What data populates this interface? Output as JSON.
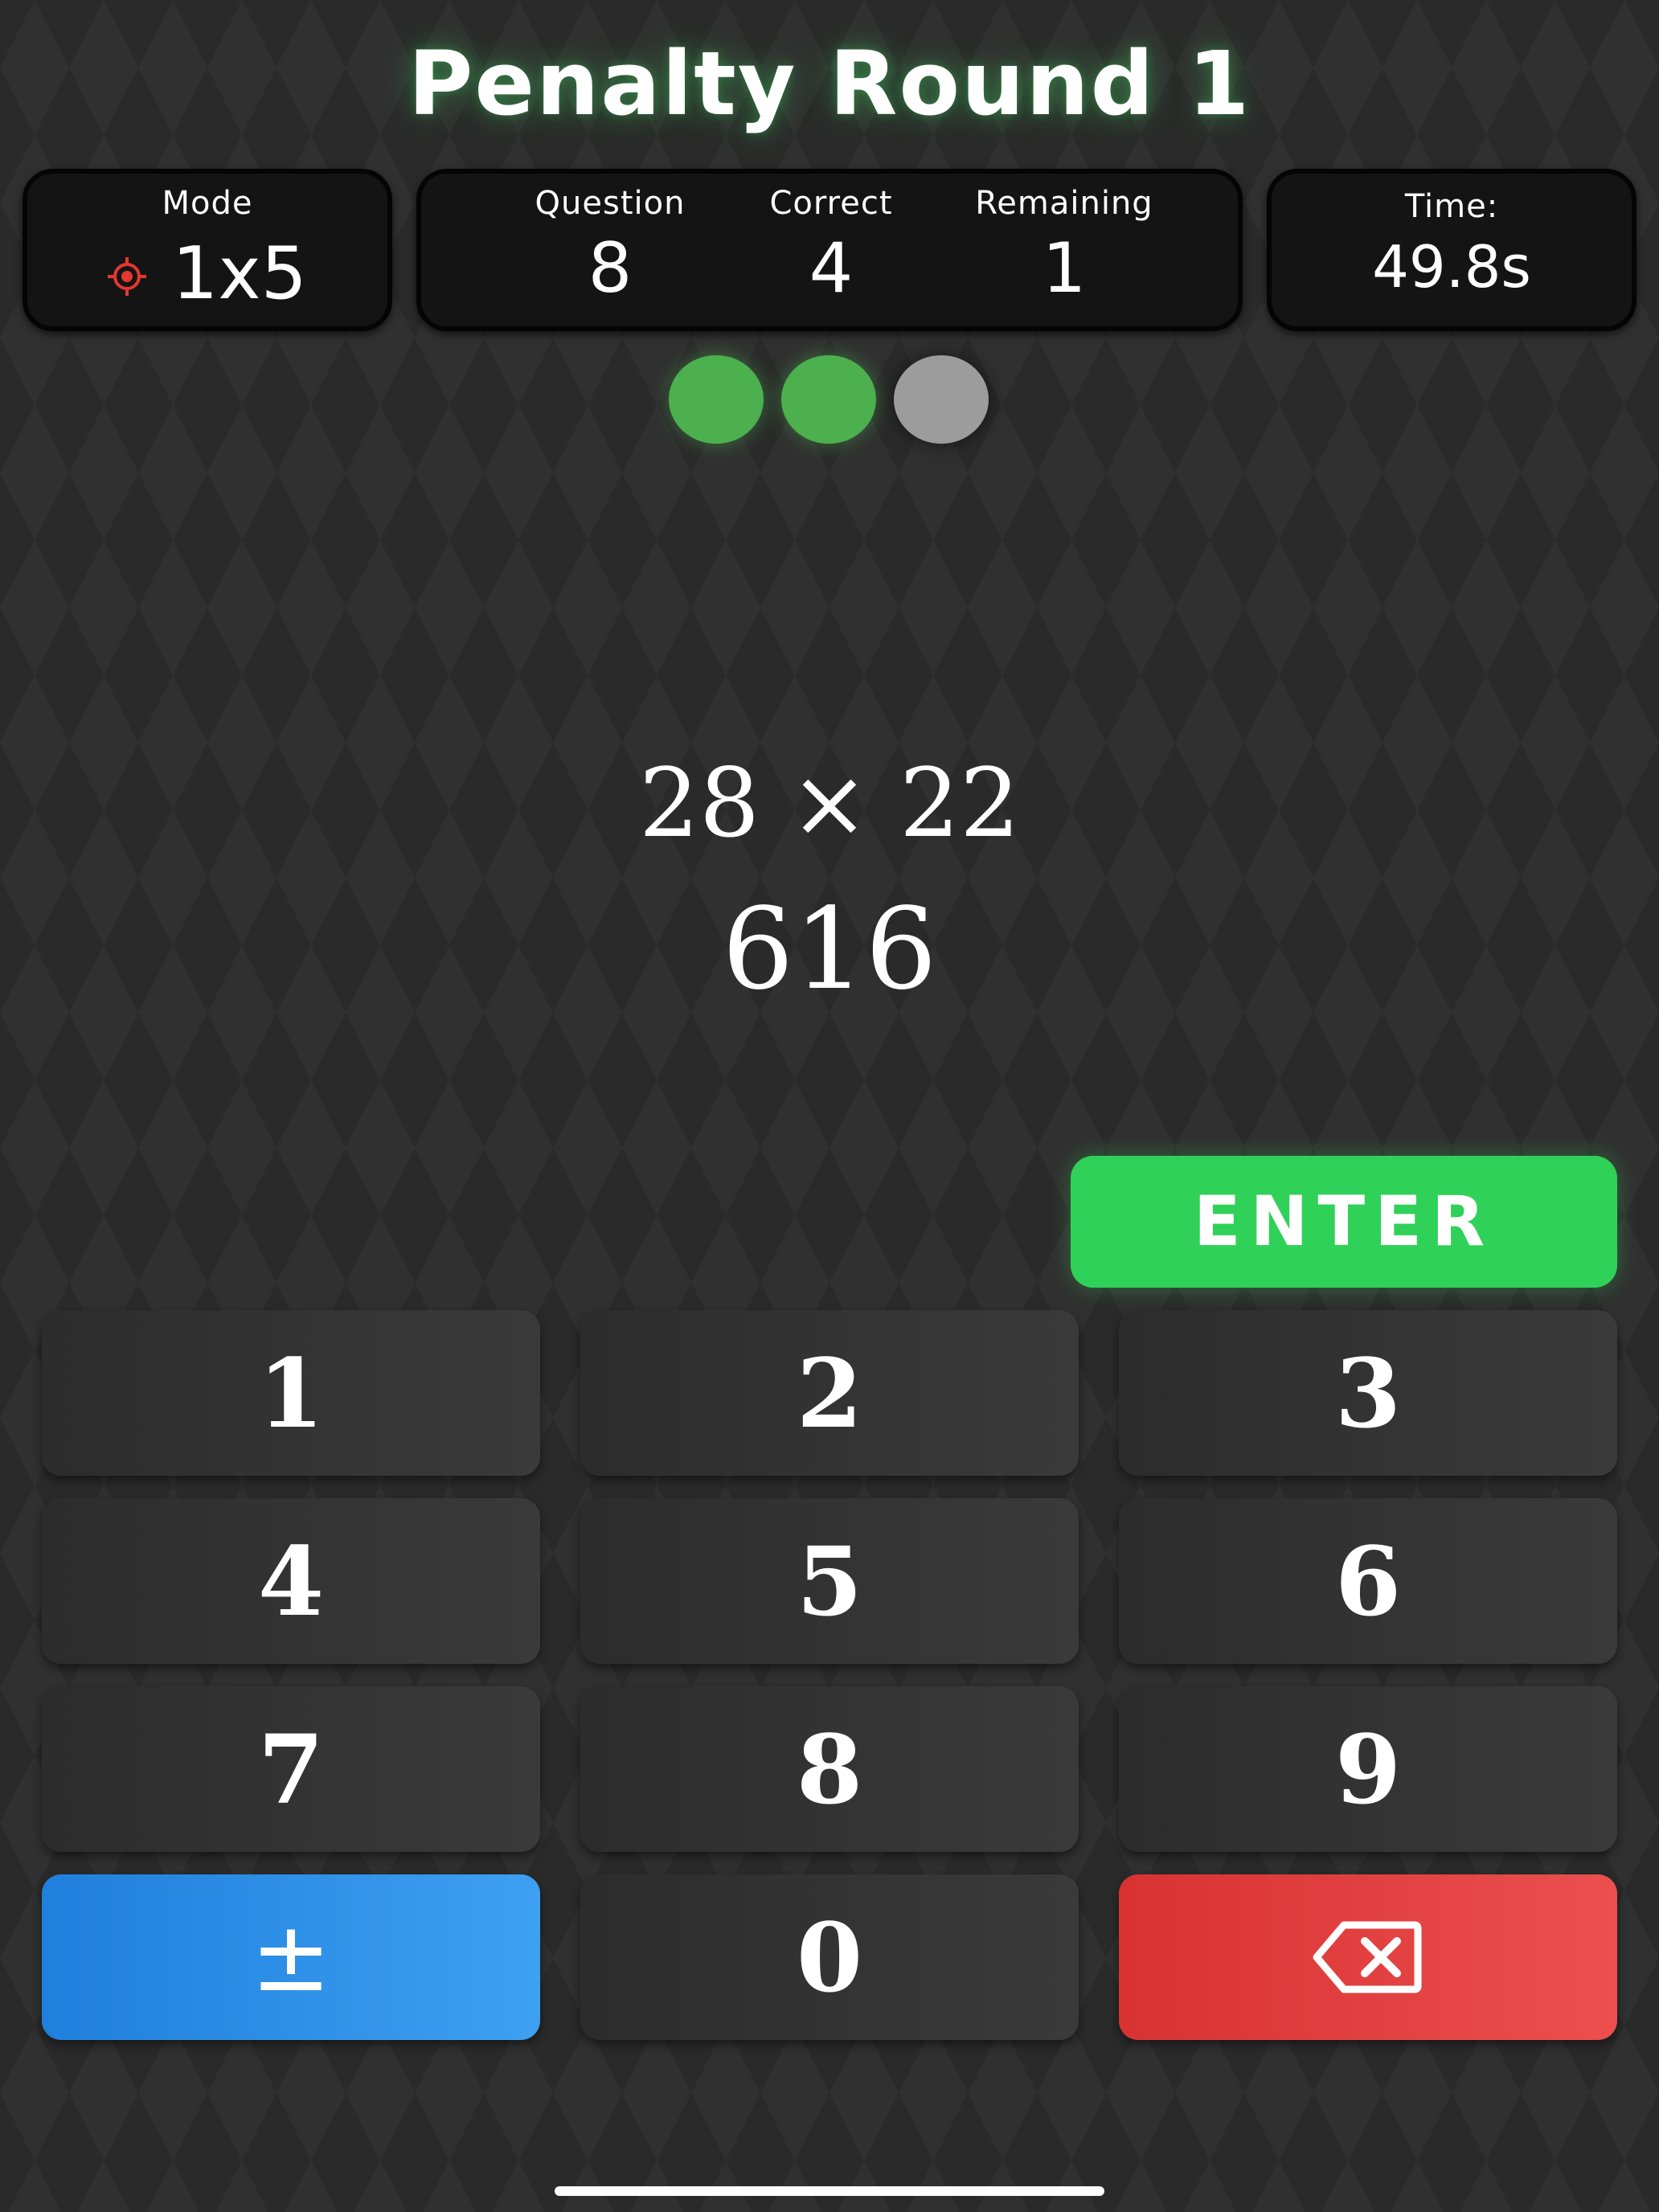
{
  "title": "Penalty Round 1",
  "mode": {
    "label": "Mode",
    "value": "1x5",
    "icon": "target-icon",
    "icon_color": "#e5372f"
  },
  "progress": {
    "question_label": "Question",
    "question_value": "8",
    "correct_label": "Correct",
    "correct_value": "4",
    "remaining_label": "Remaining",
    "remaining_value": "1"
  },
  "timer": {
    "label": "Time:",
    "value": "49.8s"
  },
  "attempts": [
    {
      "status": "correct",
      "color": "#4cb04f"
    },
    {
      "status": "correct",
      "color": "#4cb04f"
    },
    {
      "status": "pending",
      "color": "#9c9c9c"
    }
  ],
  "problem": {
    "expression": "28 × 22",
    "answer_input": "616"
  },
  "keypad": {
    "enter_label": "ENTER",
    "enter_color": "#30d158",
    "keys": [
      "1",
      "2",
      "3",
      "4",
      "5",
      "6",
      "7",
      "8",
      "9"
    ],
    "sign_label": "±",
    "sign_color": "#2a8ce6",
    "zero_label": "0",
    "delete_icon": "backspace-icon",
    "delete_color": "#e04040"
  }
}
